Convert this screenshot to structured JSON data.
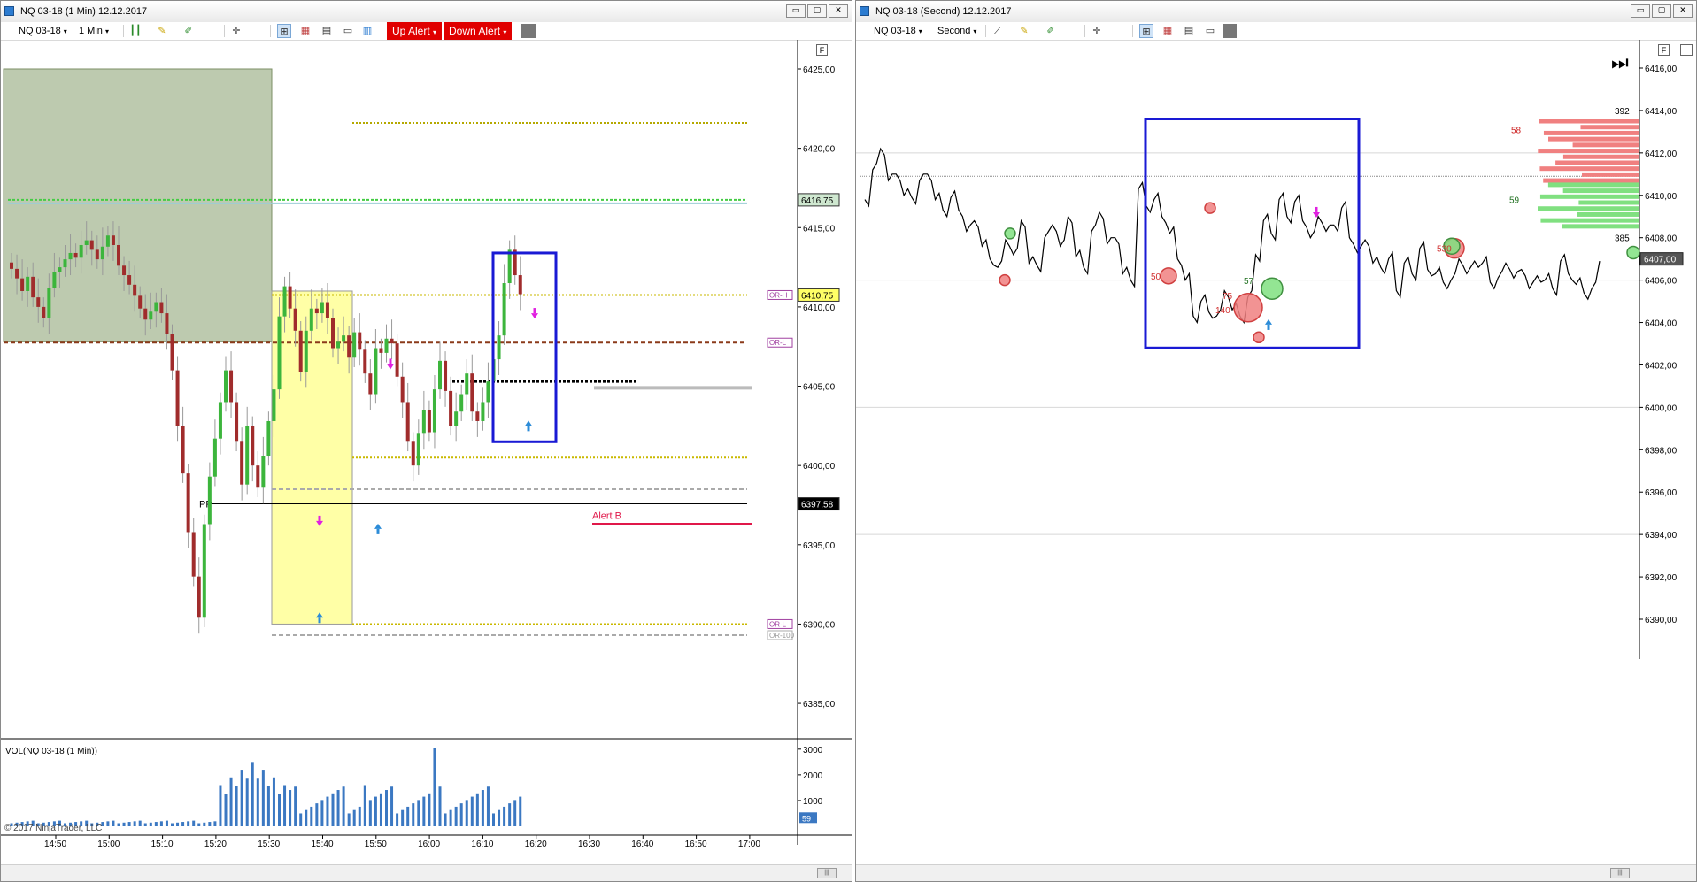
{
  "left_window": {
    "title": "NQ 03-18 (1 Min)  12.12.2017",
    "toolbar": {
      "instrument": "NQ 03-18",
      "interval": "1 Min",
      "up_alert": "Up Alert",
      "down_alert": "Down Alert"
    },
    "f_label": "F",
    "price_axis": [
      "6425,00",
      "6420,00",
      "6415,00",
      "6410,00",
      "6405,00",
      "6400,00",
      "6395,00",
      "6390,00",
      "6385,00"
    ],
    "price_flags": [
      {
        "label": "6416,75",
        "color": "#cfe8d0"
      },
      {
        "label": "6410,75",
        "color": "#ffff66"
      },
      {
        "label": "6397,58",
        "color": "#000000"
      }
    ],
    "level_tags": [
      "OR-H",
      "OR-L",
      "OR-L",
      "OR-100"
    ],
    "pp_label": "PP",
    "alert_label": "Alert B",
    "volume": {
      "label": "VOL(NQ 03-18 (1 Min))",
      "axis": [
        "3000",
        "2000",
        "1000"
      ],
      "current": "59"
    },
    "time_axis": [
      "14:50",
      "15:00",
      "15:10",
      "15:20",
      "15:30",
      "15:40",
      "15:50",
      "16:00",
      "16:10",
      "16:20",
      "16:30",
      "16:40",
      "16:50",
      "17:00"
    ],
    "copyright": "© 2017 NinjaTrader, LLC",
    "colors": {
      "up": "#3cb53c",
      "down": "#a02c2c",
      "shade": "#9aae84",
      "yellow": "#ffff80",
      "alert": "#e0184a",
      "box": "#1a1ad4"
    }
  },
  "right_window": {
    "title": "NQ 03-18 (Second)  12.12.2017",
    "toolbar": {
      "instrument": "NQ 03-18",
      "interval": "Second"
    },
    "f_label": "F",
    "price_axis": [
      "6416,00",
      "6414,00",
      "6412,00",
      "6410,00",
      "6408,00",
      "6406,00",
      "6404,00",
      "6402,00",
      "6400,00",
      "6398,00",
      "6396,00",
      "6394,00",
      "6392,00",
      "6390,00"
    ],
    "current_price": "6407,00",
    "profile_labels": [
      "392",
      "58",
      "59",
      "385"
    ],
    "bubble_labels": [
      "50",
      "75",
      "57",
      "140",
      "530"
    ],
    "colors": {
      "bid": "#f08080",
      "ask": "#80e080",
      "box": "#1a1ad4"
    }
  },
  "chart_data": [
    {
      "type": "candlestick",
      "title": "NQ 03-18 (1 Min)  12.12.2017",
      "x": [
        "14:50",
        "15:00",
        "15:10",
        "15:20",
        "15:30",
        "15:40",
        "15:50",
        "16:00",
        "16:10",
        "16:20",
        "16:30",
        "16:40",
        "16:50",
        "17:00"
      ],
      "ylim": [
        6384,
        6425
      ],
      "closes": [
        6412.4,
        6411.8,
        6411.0,
        6411.9,
        6410.6,
        6410.0,
        6409.3,
        6411.2,
        6412.2,
        6412.5,
        6413.0,
        6413.4,
        6413.1,
        6413.9,
        6414.2,
        6413.6,
        6413.0,
        6413.8,
        6414.5,
        6413.9,
        6412.6,
        6412.0,
        6411.4,
        6410.7,
        6409.9,
        6409.2,
        6409.7,
        6410.3,
        6409.6,
        6408.3,
        6406.0,
        6402.5,
        6399.5,
        6395.8,
        6393.0,
        6390.4,
        6396.3,
        6399.3,
        6401.7,
        6404.0,
        6406.0,
        6404.0,
        6401.5,
        6398.8,
        6402.5,
        6400.0,
        6398.6,
        6400.6,
        6402.8,
        6404.8,
        6409.4,
        6411.3,
        6409.9,
        6408.5,
        6405.9,
        6408.5,
        6409.9,
        6409.6,
        6410.3,
        6409.3,
        6407.4,
        6407.8,
        6408.2,
        6406.8,
        6408.4,
        6407.3,
        6405.8,
        6404.5,
        6407.4,
        6407.1,
        6408.0,
        6407.7,
        6405.6,
        6404.0,
        6401.5,
        6400.0,
        6402.0,
        6403.5,
        6402.1,
        6404.8,
        6406.6,
        6404.7,
        6402.5,
        6403.4,
        6404.5,
        6405.8,
        6403.4,
        6402.8,
        6404.0,
        6405.3,
        6406.7,
        6408.2,
        6411.5,
        6413.6,
        6412.0,
        6410.8
      ],
      "volume_ylim": [
        0,
        3200
      ],
      "pp": 6397.58,
      "alert_b": 6396.3,
      "levels": [
        {
          "name": "upper-dotted",
          "value": 6421.6
        },
        {
          "name": "green-dotted",
          "value": 6416.75
        },
        {
          "name": "or-h",
          "value": 6410.75
        },
        {
          "name": "or-l",
          "value": 6407.75
        },
        {
          "name": "black-dotted",
          "value": 6405.3
        },
        {
          "name": "gray-solid",
          "value": 6404.9
        },
        {
          "name": "yellow-mid",
          "value": 6400.5
        },
        {
          "name": "gray-dashed",
          "value": 6398.5
        },
        {
          "name": "or-low",
          "value": 6390.0
        },
        {
          "name": "or-100",
          "value": 6389.3
        }
      ]
    },
    {
      "type": "line",
      "title": "NQ 03-18 (Second)  12.12.2017",
      "ylim": [
        6389,
        6417
      ],
      "values": [
        6409.8,
        6411.2,
        6412.2,
        6410.7,
        6411.0,
        6410.0,
        6409.9,
        6410.7,
        6411.0,
        6409.8,
        6409.3,
        6409.9,
        6409.3,
        6408.3,
        6408.8,
        6407.6,
        6407.0,
        6406.6,
        6407.9,
        6407.2,
        6408.8,
        6406.8,
        6406.7,
        6408.0,
        6408.6,
        6407.6,
        6409.0,
        6407.1,
        6406.6,
        6408.3,
        6409.2,
        6407.7,
        6408.0,
        6406.3,
        6406.0,
        6410.3,
        6409.5,
        6409.8,
        6409.0,
        6408.2,
        6407.0,
        6406.0,
        6404.3,
        6405.0,
        6404.5,
        6404.3,
        6405.5,
        6404.6,
        6404.3,
        6405.2,
        6407.2,
        6408.8,
        6408.2,
        6409.8,
        6409.0,
        6409.7,
        6408.8,
        6408.0,
        6409.0,
        6408.3,
        6408.6,
        6409.4,
        6408.0,
        6407.3,
        6407.9,
        6406.8,
        6406.6,
        6407.0,
        6405.5,
        6406.8,
        6406.3,
        6407.5,
        6406.5,
        6406.3,
        6405.9,
        6406.0,
        6407.0,
        6406.3,
        6406.9,
        6406.8,
        6405.9,
        6406.1,
        6406.8,
        6406.1,
        6406.5,
        6405.6,
        6406.2,
        6406.0,
        6405.6,
        6406.9,
        6406.3,
        6405.8,
        6405.4,
        6405.6,
        6406.9
      ]
    }
  ]
}
